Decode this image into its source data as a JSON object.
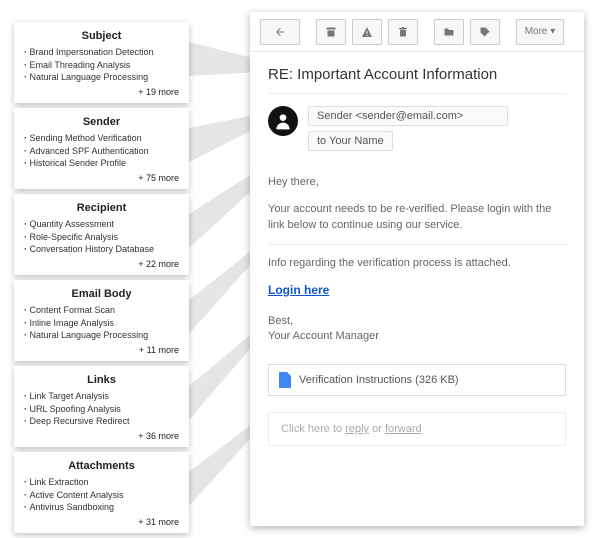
{
  "toolbar": {
    "more_label": "More ▾"
  },
  "email": {
    "subject": "RE: Important Account Information",
    "sender_chip": "Sender <sender@email.com>",
    "recipient_chip": "to Your Name",
    "greeting": "Hey there,",
    "body_p1": "Your account needs to be re-verified. Please login with the link below to continue using our service.",
    "body_p2": "Info regarding the verification process is attached.",
    "link_label": "Login here",
    "signoff_1": "Best,",
    "signoff_2": "Your Account Manager",
    "attachment_label": "Verification Instructions (326 KB)",
    "reply_prefix": "Click here to ",
    "reply_reply": "reply",
    "reply_or": " or ",
    "reply_forward": "forward"
  },
  "callouts": [
    {
      "title": "Subject",
      "items": [
        "Brand Impersonation Detection",
        "Email Threading Analysis",
        "Natural Language Processing"
      ],
      "more": "+ 19 more"
    },
    {
      "title": "Sender",
      "items": [
        "Sending Method Verification",
        "Advanced SPF Authentication",
        "Historical Sender Profile"
      ],
      "more": "+ 75 more"
    },
    {
      "title": "Recipient",
      "items": [
        "Quantity Assessment",
        "Role-Specific Analysis",
        "Conversation History Database"
      ],
      "more": "+ 22 more"
    },
    {
      "title": "Email Body",
      "items": [
        "Content Format Scan",
        "Inline Image Analysis",
        "Natural Language Processing"
      ],
      "more": "+ 11 more"
    },
    {
      "title": "Links",
      "items": [
        "Link Target Analysis",
        "URL Spoofing Analysis",
        "Deep Recursive Redirect"
      ],
      "more": "+ 36 more"
    },
    {
      "title": "Attachments",
      "items": [
        "Link Extraction",
        "Active Content Analysis",
        "Antivirus Sandboxing"
      ],
      "more": "+ 31 more"
    }
  ]
}
